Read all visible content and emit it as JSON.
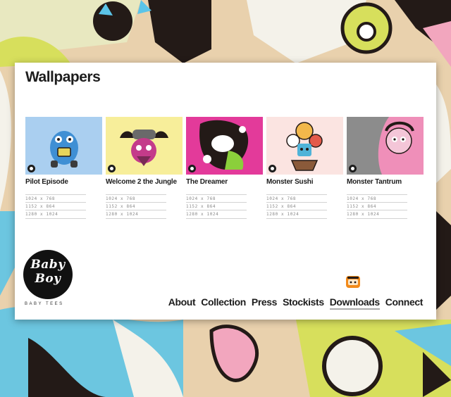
{
  "page": {
    "title": "Wallpapers"
  },
  "colors": {
    "panel": "#ffffff",
    "text": "#1d1d1d",
    "muted": "#8a8a8a",
    "mascot": "#f28a1a"
  },
  "wallpapers": [
    {
      "name": "Pilot Episode",
      "thumb_bg": "#aacff0",
      "accent": "#3f8fd4",
      "icon": "monster-character-thumbnail",
      "sizes": [
        "1024 x 768",
        "1152 x 864",
        "1280 x 1024"
      ]
    },
    {
      "name": "Welcome 2 the Jungle",
      "thumb_bg": "#f7ee9a",
      "accent": "#c43b8a",
      "icon": "viking-character-thumbnail",
      "sizes": [
        "1024 x 768",
        "1152 x 864",
        "1280 x 1024"
      ]
    },
    {
      "name": "The Dreamer",
      "thumb_bg": "#e33a9a",
      "accent": "#8bcf3b",
      "icon": "dreamer-character-thumbnail",
      "sizes": [
        "1024 x 768",
        "1152 x 864",
        "1280 x 1024"
      ]
    },
    {
      "name": "Monster Sushi",
      "thumb_bg": "#fbe4e1",
      "accent": "#4fb3d8",
      "icon": "sushi-character-thumbnail",
      "sizes": [
        "1024 x 768",
        "1152 x 864",
        "1280 x 1024"
      ]
    },
    {
      "name": "Monster Tantrum",
      "thumb_bg": "#8c8c8c",
      "accent": "#ef8fb9",
      "icon": "monkey-character-thumbnail",
      "sizes": [
        "1024 x 768",
        "1152 x 864",
        "1280 x 1024"
      ]
    }
  ],
  "brand": {
    "line1": "Baby",
    "line2": "Boy",
    "tagline": "BABY TEES"
  },
  "nav": [
    {
      "label": "About"
    },
    {
      "label": "Collection"
    },
    {
      "label": "Press"
    },
    {
      "label": "Stockists"
    },
    {
      "label": "Downloads",
      "active": true
    },
    {
      "label": "Connect"
    }
  ]
}
